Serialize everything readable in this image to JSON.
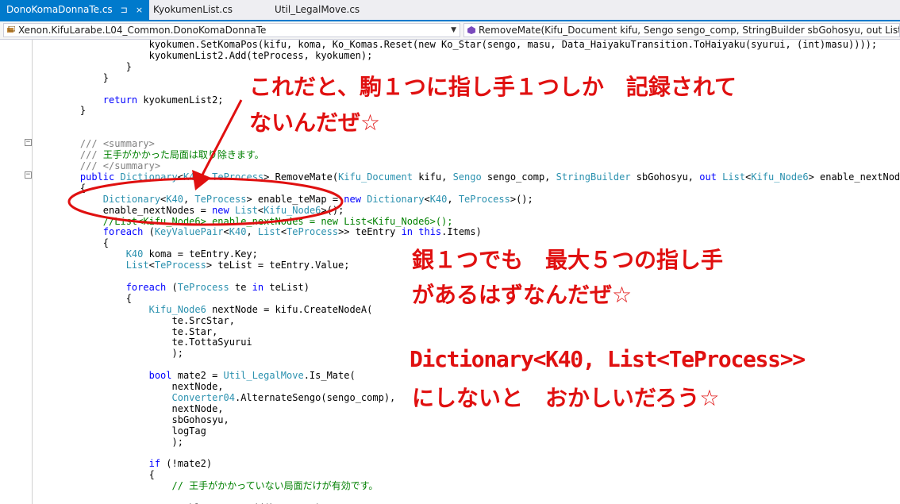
{
  "tabs": [
    {
      "label": "DonoKomaDonnaTe.cs",
      "active": true,
      "pin": "⊐",
      "close": "×"
    },
    {
      "label": "KyokumenList.cs",
      "active": false
    },
    {
      "label": "Util_LegalMove.cs",
      "active": false
    }
  ],
  "nav": {
    "left": "Xenon.KifuLarabe.L04_Common.DonoKomaDonnaTe",
    "right": "RemoveMate(Kifu_Document kifu, Sengo sengo_comp, StringBuilder sbGohosyu, out List<Kifu_Node6> enable_nextNodes, L"
  },
  "annotations": {
    "note1_line1": "これだと、駒１つに指し手１つしか　記録されて",
    "note1_line2": "ないんだぜ☆",
    "note2_line1": "銀１つでも　最大５つの指し手",
    "note2_line2": "があるはずなんだぜ☆",
    "note3_line1": "Dictionary<K40, List<TeProcess>>",
    "note3_line2": "にしないと　おかしいだろう☆"
  },
  "colors": {
    "annotation": "#e01010",
    "accent": "#007acc",
    "keyword": "#0000ff",
    "type": "#2b91af",
    "comment": "#008000"
  }
}
